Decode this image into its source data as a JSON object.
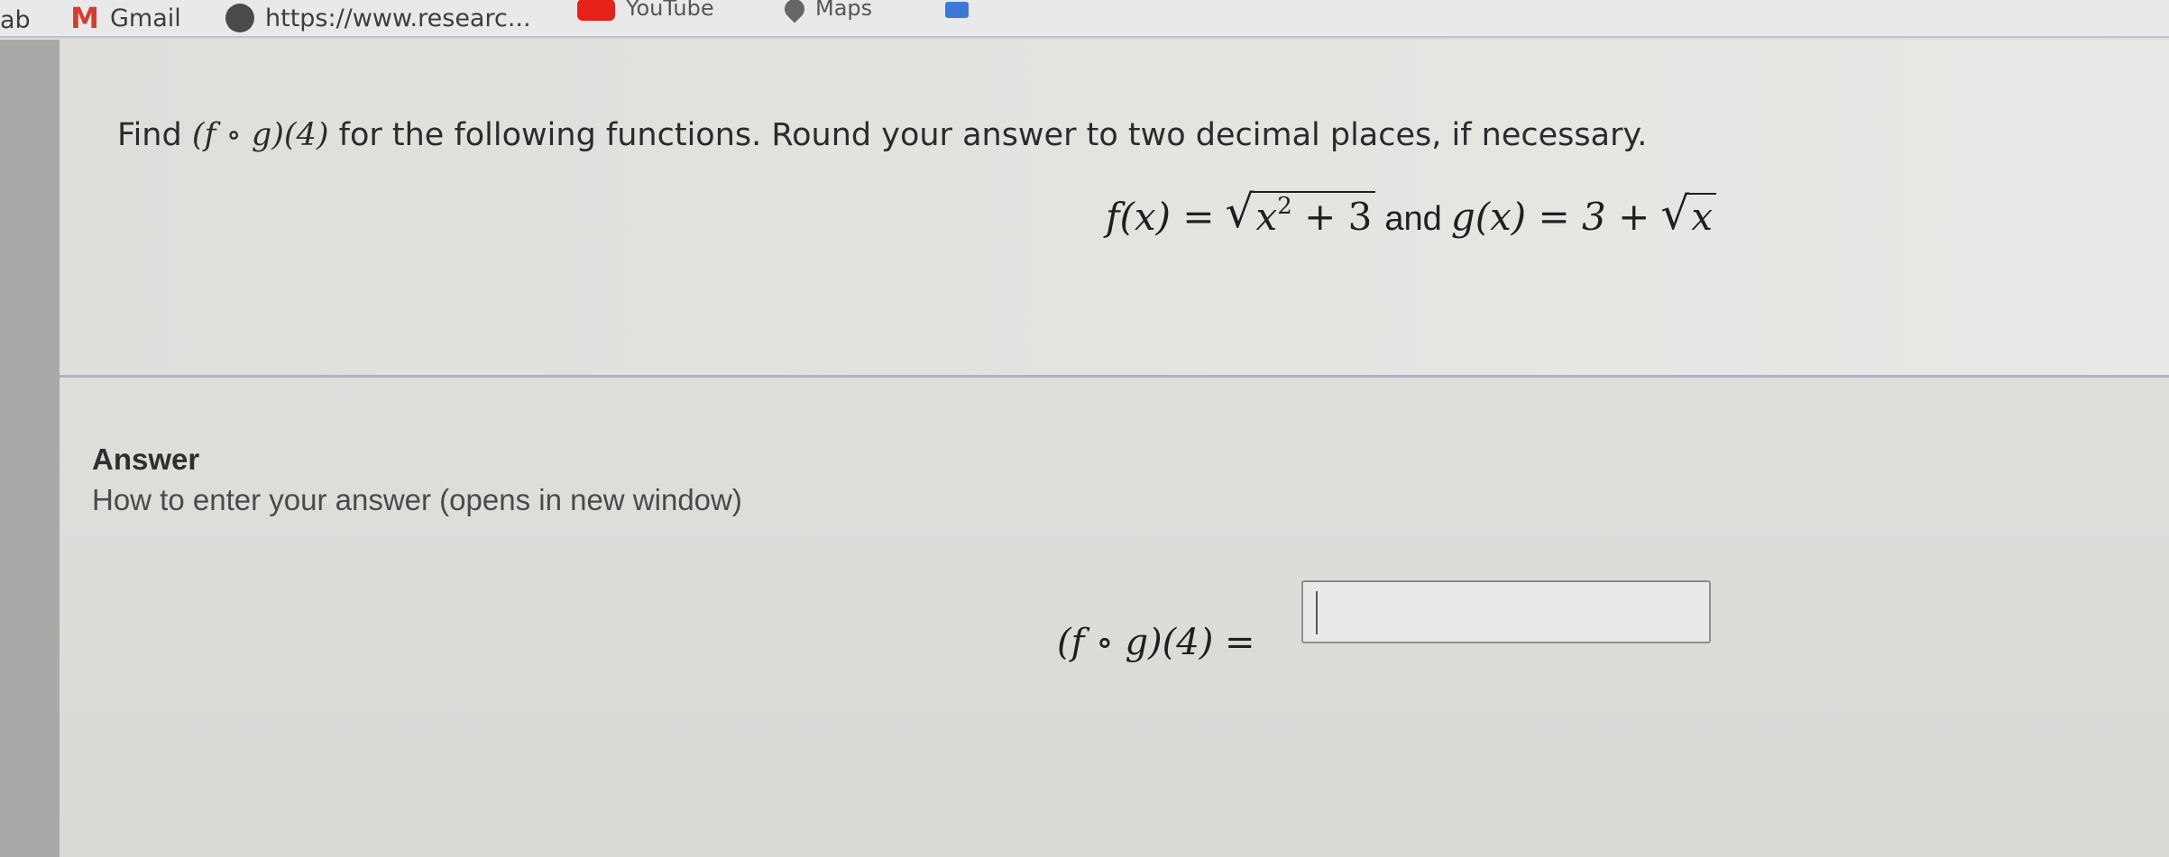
{
  "bookmarks": {
    "tab_label": "ab",
    "gmail_label": "Gmail",
    "research_label": "https://www.researc...",
    "youtube_label": "YouTube",
    "maps_label": "Maps"
  },
  "question": {
    "prompt_find": "Find ",
    "prompt_expr": "(f ∘ g)(4)",
    "prompt_rest": " for the following functions. Round your answer to two decimal places, if necessary.",
    "f_lhs": "f(x) =",
    "f_radicand": "x",
    "f_power": "2",
    "f_tail": "+ 3",
    "connector": "and",
    "g_lhs": "g(x) = 3 +",
    "g_radicand": "x"
  },
  "answer": {
    "title": "Answer",
    "help_link": "How to enter your answer (opens in new window)",
    "expression": "(f ∘ g)(4) =",
    "input_value": ""
  }
}
